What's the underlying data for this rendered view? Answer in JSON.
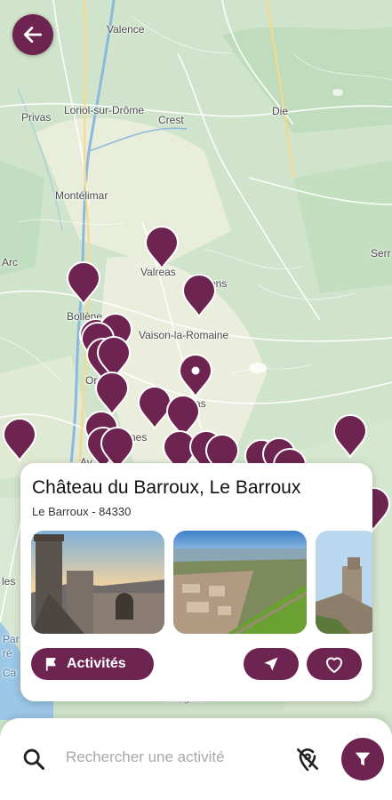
{
  "map": {
    "places": [
      {
        "id": "valence",
        "name": "Valence"
      },
      {
        "id": "privas",
        "name": "Privas"
      },
      {
        "id": "loriol",
        "name": "Loriol-sur-Drôme"
      },
      {
        "id": "crest",
        "name": "Crest"
      },
      {
        "id": "die",
        "name": "Die"
      },
      {
        "id": "montelimar",
        "name": "Montélimar"
      },
      {
        "id": "arc",
        "name": "Arc"
      },
      {
        "id": "valreas",
        "name": "Valréas"
      },
      {
        "id": "nyons",
        "name": "ons"
      },
      {
        "id": "serres",
        "name": "Serr"
      },
      {
        "id": "bollene",
        "name": "Bollène"
      },
      {
        "id": "vaison",
        "name": "Vaison-la-Romaine"
      },
      {
        "id": "orange",
        "name": "Or"
      },
      {
        "id": "carpentras",
        "name": "as"
      },
      {
        "id": "avignon",
        "name": "Av"
      },
      {
        "id": "nes",
        "name": "nes"
      },
      {
        "id": "les",
        "name": "les"
      },
      {
        "id": "marigues",
        "name": "Marigues"
      },
      {
        "id": "parc",
        "name": "Par"
      },
      {
        "id": "reg",
        "name": "ré"
      },
      {
        "id": "ca",
        "name": "Ca"
      }
    ],
    "accent_color": "#6e2450"
  },
  "back_button": {
    "icon": "arrow-left-icon"
  },
  "card": {
    "title": "Château du Barroux, Le Barroux",
    "subtitle": "Le Barroux - 84330",
    "activities_label": "Activités",
    "activities_icon": "flag-icon",
    "navigate_icon": "navigation-arrow-icon",
    "favorite_icon": "heart-icon"
  },
  "search": {
    "placeholder": "Rechercher une activité",
    "search_icon": "search-icon",
    "location_off_icon": "location-off-icon",
    "filter_icon": "filter-icon"
  }
}
